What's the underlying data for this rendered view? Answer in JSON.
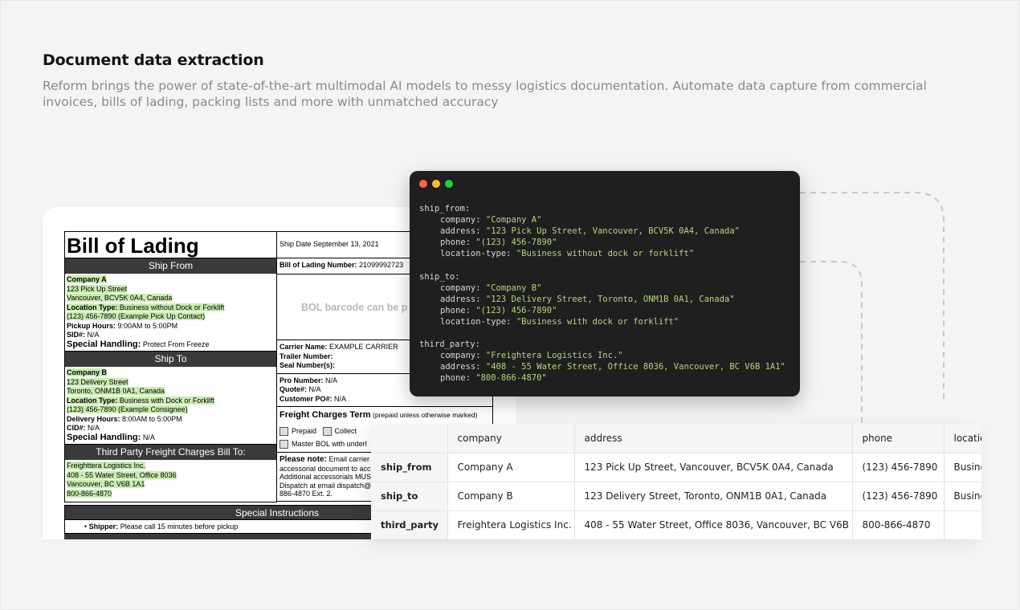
{
  "header": {
    "title": "Document data extraction",
    "subtitle": "Reform brings the power of state-of-the-art multimodal AI models to messy logistics documentation. Automate data capture from commercial invoices, bills of lading, packing lists and more with unmatched accuracy"
  },
  "document": {
    "title": "Bill of Lading",
    "ship_date": "Ship Date September 13, 2021",
    "bol_number_label": "Bill of Lading Number:",
    "bol_number": "21099992723",
    "barcode_text": "BOL barcode can be p",
    "ship_from_bar": "Ship From",
    "ship_from": {
      "company": "Company A",
      "street": "123 Pick Up Street",
      "city": "Vancouver, BCV5K 0A4, Canada",
      "location_type_label": "Location Type:",
      "location_type": "Business without Dock or Forklift",
      "phone": "(123) 456-7890 (Example Pick Up Contact)",
      "hours_label": "Pickup Hours:",
      "hours": "9:00AM to 5:00PM",
      "sid_label": "SID#:",
      "sid": "N/A",
      "special_label": "Special Handling:",
      "special": "Protect From Freeze"
    },
    "ship_to_bar": "Ship To",
    "ship_to": {
      "company": "Company B",
      "street": "123 Delivery Street",
      "city": "Toronto, ONM1B 0A1, Canada",
      "location_type_label": "Location Type:",
      "location_type": "Business with Dock or Forklift",
      "phone": "(123) 456-7890 (Example Consignee)",
      "hours_label": "Delivery Hours:",
      "hours": "8:00AM to 5:00PM",
      "cid_label": "CID#:",
      "cid": "N/A",
      "special_label": "Special Handling:",
      "special": "N/A"
    },
    "third_party_bar": "Third Party Freight Charges Bill To:",
    "third_party": {
      "company": "Freighttera Logistics Inc.",
      "street": "408 - 55 Water Street, Office 8036",
      "city": "Vancouver, BC V6B 1A1",
      "phone": "800-866-4870"
    },
    "carrier_label": "Carrier Name:",
    "carrier": "EXAMPLE CARRIER",
    "trailer_label": "Trailer Number:",
    "seal_label": "Seal Number(s):",
    "pro_label": "Pro Number:",
    "pro": "N/A",
    "quote_label": "Quote#:",
    "quote": "N/A",
    "po_label": "Customer PO#:",
    "po": "N/A",
    "freight_term_label": "Freight Charges Term",
    "freight_term_note": "(prepaid unless otherwise marked)",
    "prepaid": "Prepaid",
    "collect": "Collect",
    "master_bol": "Master BOL with underl",
    "note_label": "Please note:",
    "note_lines": [
      "Email carrier",
      "accessorial document to acc",
      "Additional accessorials MUS",
      "Dispatch at email dispatch@",
      "886-4870 Ext. 2."
    ],
    "special_instructions_bar": "Special Instructions",
    "shipper_label": "Shipper:",
    "shipper_note": "Please call 15 minutes before pickup"
  },
  "code": {
    "lines": [
      {
        "indent": 0,
        "key": "ship_from:",
        "val": ""
      },
      {
        "indent": 1,
        "key": "company: ",
        "val": "\"Company A\""
      },
      {
        "indent": 1,
        "key": "address: ",
        "val": "\"123 Pick Up Street, Vancouver, BCV5K 0A4, Canada\""
      },
      {
        "indent": 1,
        "key": "phone: ",
        "val": "\"(123) 456-7890\""
      },
      {
        "indent": 1,
        "key": "location-type: ",
        "val": "\"Business without dock or forklift\""
      },
      {
        "indent": 0,
        "key": "",
        "val": ""
      },
      {
        "indent": 0,
        "key": "ship_to:",
        "val": ""
      },
      {
        "indent": 1,
        "key": "company: ",
        "val": "\"Company B\""
      },
      {
        "indent": 1,
        "key": "address: ",
        "val": "\"123 Delivery Street, Toronto, ONM1B 0A1, Canada\""
      },
      {
        "indent": 1,
        "key": "phone: ",
        "val": "\"(123) 456-7890\""
      },
      {
        "indent": 1,
        "key": "location-type: ",
        "val": "\"Business with dock or forklift\""
      },
      {
        "indent": 0,
        "key": "",
        "val": ""
      },
      {
        "indent": 0,
        "key": "third_party:",
        "val": ""
      },
      {
        "indent": 1,
        "key": "company: ",
        "val": "\"Freightera Logistics Inc.\""
      },
      {
        "indent": 1,
        "key": "address: ",
        "val": "\"408 - 55 Water Street, Office 8036, Vancouver, BC V6B 1A1\""
      },
      {
        "indent": 1,
        "key": "phone: ",
        "val": "\"800-866-4870\""
      }
    ],
    "dot_colors": [
      "#ff5f57",
      "#febc2e",
      "#28c840"
    ]
  },
  "table": {
    "columns": [
      "",
      "company",
      "address",
      "phone",
      "locatio"
    ],
    "rows": [
      {
        "key": "ship_from",
        "company": "Company A",
        "address": "123 Pick Up Street, Vancouver, BCV5K 0A4, Canada",
        "phone": "(123) 456-7890",
        "location": "Busine"
      },
      {
        "key": "ship_to",
        "company": "Company B",
        "address": "123 Delivery Street, Toronto, ONM1B 0A1, Canada",
        "phone": "(123) 456-7890",
        "location": "Busine"
      },
      {
        "key": "third_party",
        "company": "Freightera Logistics Inc.",
        "address": "408 - 55 Water Street, Office 8036, Vancouver, BC V6B 1A1",
        "phone": "800-866-4870",
        "location": ""
      }
    ]
  }
}
